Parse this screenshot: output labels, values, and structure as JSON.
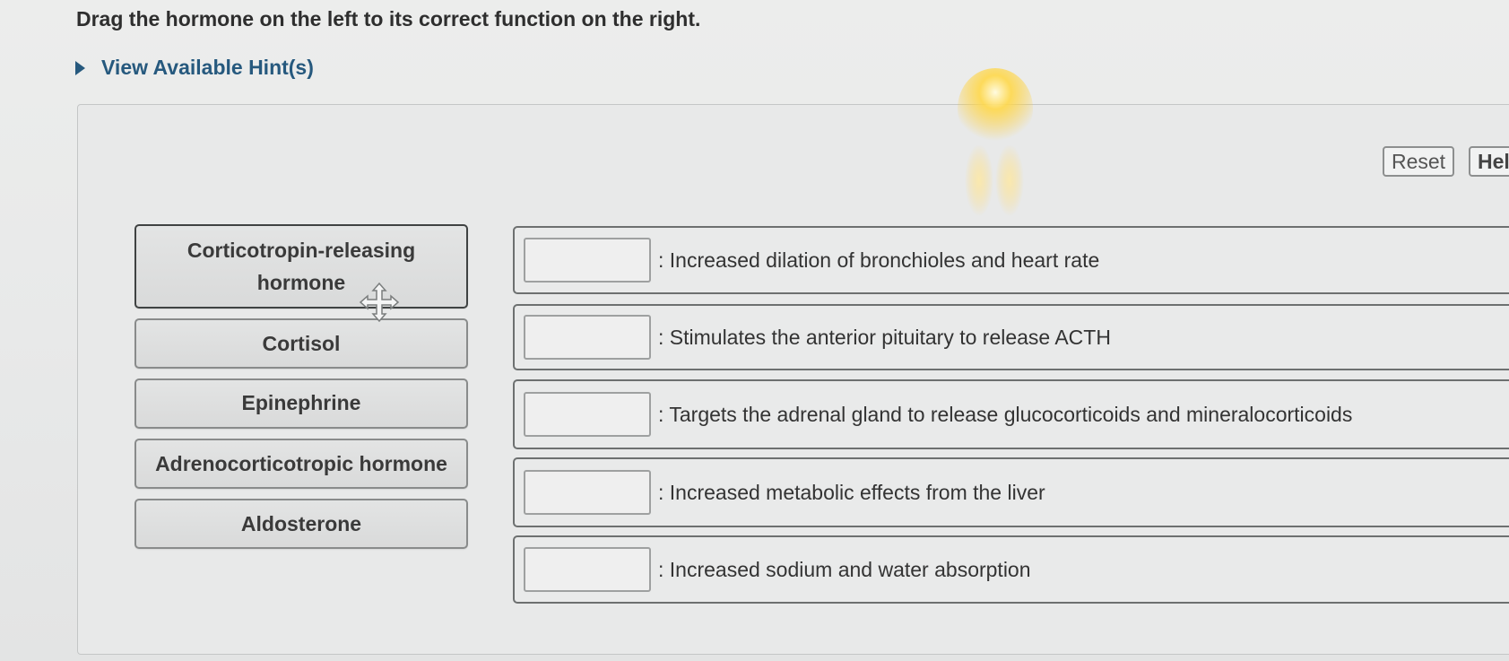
{
  "instructions": "Drag the hormone on the left to its correct function on the right.",
  "hints": {
    "label": "View Available Hint(s)",
    "icon": "caret-right-icon"
  },
  "toolbar": {
    "reset_label": "Reset",
    "help_label": "Hel"
  },
  "hormones": [
    {
      "label_line1": "Corticotropin-releasing",
      "label_line2": "hormone"
    },
    {
      "label": "Cortisol"
    },
    {
      "label": "Epinephrine"
    },
    {
      "label": "Adrenocorticotropic hormone"
    },
    {
      "label": "Aldosterone"
    }
  ],
  "functions": [
    {
      "label": ": Increased dilation of bronchioles and heart rate"
    },
    {
      "label": ": Stimulates the anterior pituitary to release ACTH"
    },
    {
      "label": ": Targets the adrenal gland to release glucocorticoids and mineralocorticoids"
    },
    {
      "label": ": Increased metabolic effects from the liver"
    },
    {
      "label": ": Increased sodium and water absorption"
    }
  ],
  "colors": {
    "hint_link": "#26597e",
    "item_border": "#898b8b",
    "row_border": "#6d7070"
  }
}
